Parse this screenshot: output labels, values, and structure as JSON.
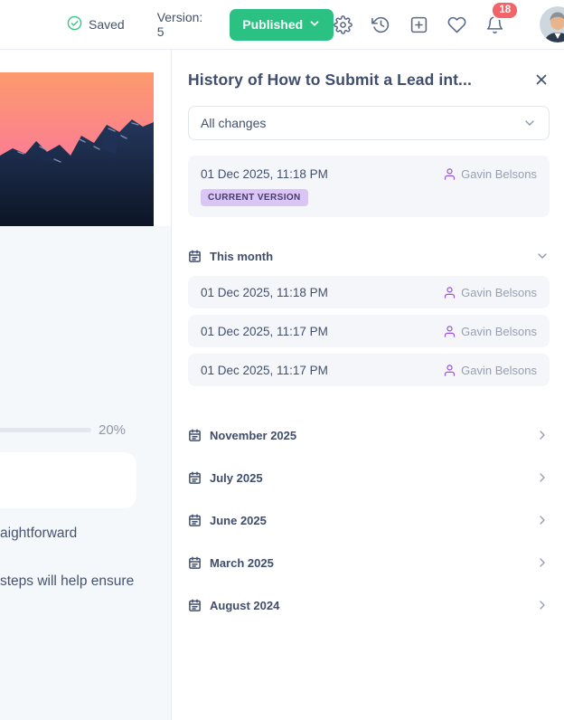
{
  "topbar": {
    "saved_label": "Saved",
    "version_label": "Version: 5",
    "published_label": "Published",
    "notification_count": "18",
    "icons": [
      "check-circle-icon",
      "gear-icon",
      "history-icon",
      "plus-square-icon",
      "heart-icon",
      "bell-icon",
      "avatar"
    ]
  },
  "document": {
    "progress_percent": "20%",
    "visible_line_1": "aightforward",
    "visible_line_2": "steps will help ensure"
  },
  "history_panel": {
    "title": "History of How to Submit a Lead int...",
    "filter_value": "All changes",
    "current_version": {
      "timestamp": "01 Dec 2025, 11:18 PM",
      "badge": "CURRENT VERSION",
      "author": "Gavin Belsons"
    },
    "this_month": {
      "label": "This month",
      "entries": [
        {
          "timestamp": "01 Dec 2025, 11:18 PM",
          "author": "Gavin Belsons"
        },
        {
          "timestamp": "01 Dec 2025, 11:17 PM",
          "author": "Gavin Belsons"
        },
        {
          "timestamp": "01 Dec 2025, 11:17 PM",
          "author": "Gavin Belsons"
        }
      ]
    },
    "collapsed_sections": [
      {
        "label": "November 2025"
      },
      {
        "label": "July 2025"
      },
      {
        "label": "June 2025"
      },
      {
        "label": "March 2025"
      },
      {
        "label": "August 2024"
      }
    ]
  },
  "colors": {
    "accent_green": "#2bc183",
    "accent_purple": "#9b51e5",
    "badge_bg": "#d9c6f4",
    "notification_red": "#f2636a",
    "text_slate": "#42506f",
    "text_gray": "#97a0b2",
    "card_bg": "#f4f6f9",
    "left_pane_bg": "#f5f8fb"
  }
}
